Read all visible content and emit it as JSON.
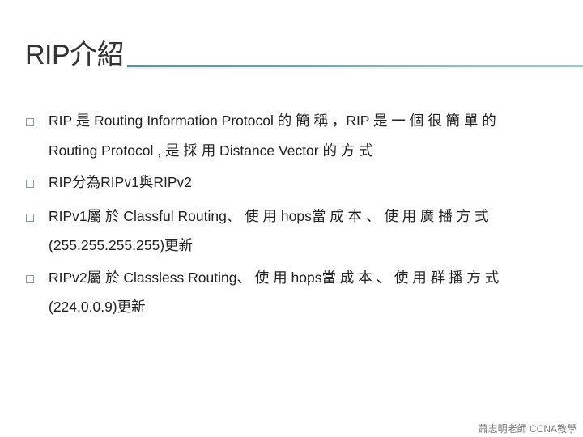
{
  "slide": {
    "title": "RIP介紹",
    "bullets": [
      {
        "lines": [
          "RIP 是 Routing Information Protocol 的 簡 稱 ，RIP 是 一 個 很 簡 單 的",
          "Routing Protocol , 是 採 用 Distance Vector 的 方 式"
        ]
      },
      {
        "lines": [
          "RIP分為RIPv1與RIPv2"
        ]
      },
      {
        "lines": [
          "RIPv1屬 於 Classful   Routing、 使 用 hops當 成 本 、 使 用 廣 播 方 式",
          "(255.255.255.255)更新"
        ]
      },
      {
        "lines": [
          "RIPv2屬 於 Classless   Routing、 使 用 hops當 成 本 、 使 用 群 播 方 式",
          "(224.0.0.9)更新"
        ]
      }
    ],
    "bullet_icon": "hollow-square-icon",
    "footer": "蕭志明老師 CCNA教學"
  },
  "colors": {
    "title_rule": "#6f9c9c",
    "text": "#222222",
    "footer": "#7a7a7a"
  }
}
